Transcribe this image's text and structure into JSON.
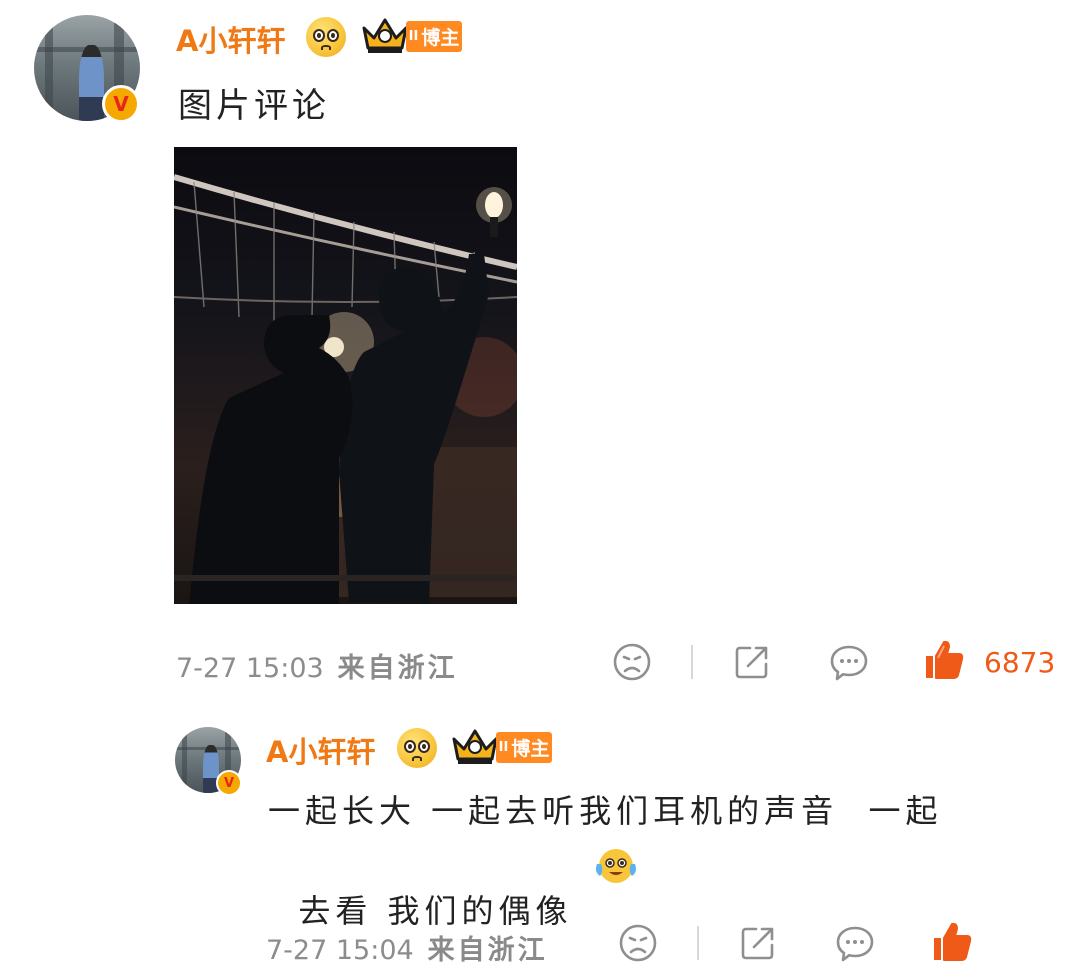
{
  "post": {
    "author": "A小轩轩",
    "badge_label": "博主",
    "crown_level": "II",
    "verified_mark": "V",
    "text": "图片评论",
    "time": "7-27 15:03",
    "location": "来自浙江",
    "likes": "6873"
  },
  "reply": {
    "author": "A小轩轩",
    "badge_label": "博主",
    "crown_level": "II",
    "verified_mark": "V",
    "text_line1": "一起长大 一起去听我们耳机的声音  一起",
    "text_line2": "去看 我们的偶像",
    "time": "7-27 15:04",
    "location": "来自浙江"
  },
  "colors": {
    "author_orange": "#ef7a15",
    "like_orange": "#ef5a18",
    "meta_gray": "#8c8c8c",
    "icon_gray": "#8f8f8f"
  },
  "icons": [
    "pleading-face-icon",
    "crown-icon",
    "sad-face-icon",
    "share-icon",
    "comment-icon",
    "thumbs-up-icon",
    "crying-laughing-face-icon"
  ]
}
